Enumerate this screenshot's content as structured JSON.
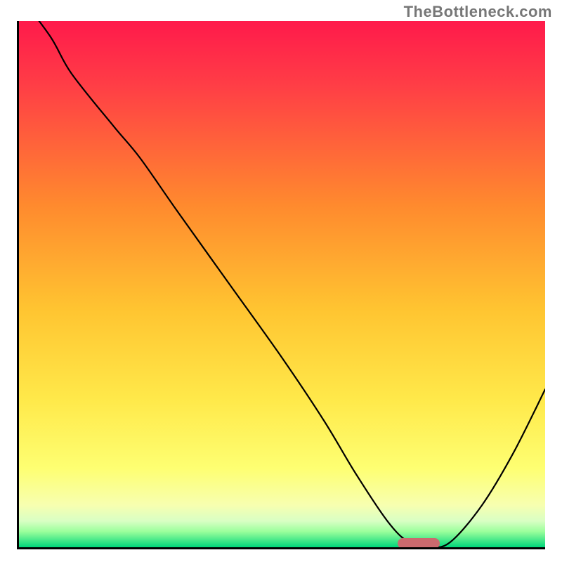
{
  "watermark": "TheBottleneck.com",
  "colors": {
    "gradient_top": "#ff1a4b",
    "gradient_mid1": "#ff7a2e",
    "gradient_mid2": "#ffd23a",
    "gradient_low1": "#feff6c",
    "gradient_low2": "#f7ffa8",
    "gradient_band": "#9cff9c",
    "gradient_bottom": "#00d67a",
    "curve": "#000000",
    "marker": "#cb6a6e",
    "axis": "#000000"
  },
  "chart_data": {
    "type": "line",
    "title": "",
    "xlabel": "",
    "ylabel": "",
    "xlim": [
      0,
      100
    ],
    "ylim": [
      0,
      100
    ],
    "x": [
      0,
      6,
      10,
      18,
      23,
      30,
      40,
      50,
      58,
      64,
      70,
      74,
      78,
      82,
      88,
      94,
      100
    ],
    "values": [
      105,
      97,
      90,
      80,
      74,
      64,
      50,
      36,
      24,
      14,
      5,
      1,
      0,
      1,
      8,
      18,
      30
    ],
    "marker_x_range": [
      72,
      80
    ],
    "marker_y": 0.8,
    "notes": "Curve shows a bottleneck-style plot: high mismatch (red) on left descending to a minimum (green) near x≈76, then rising again. Background is a vertical bottleneck gradient red→orange→yellow→pale→green."
  }
}
